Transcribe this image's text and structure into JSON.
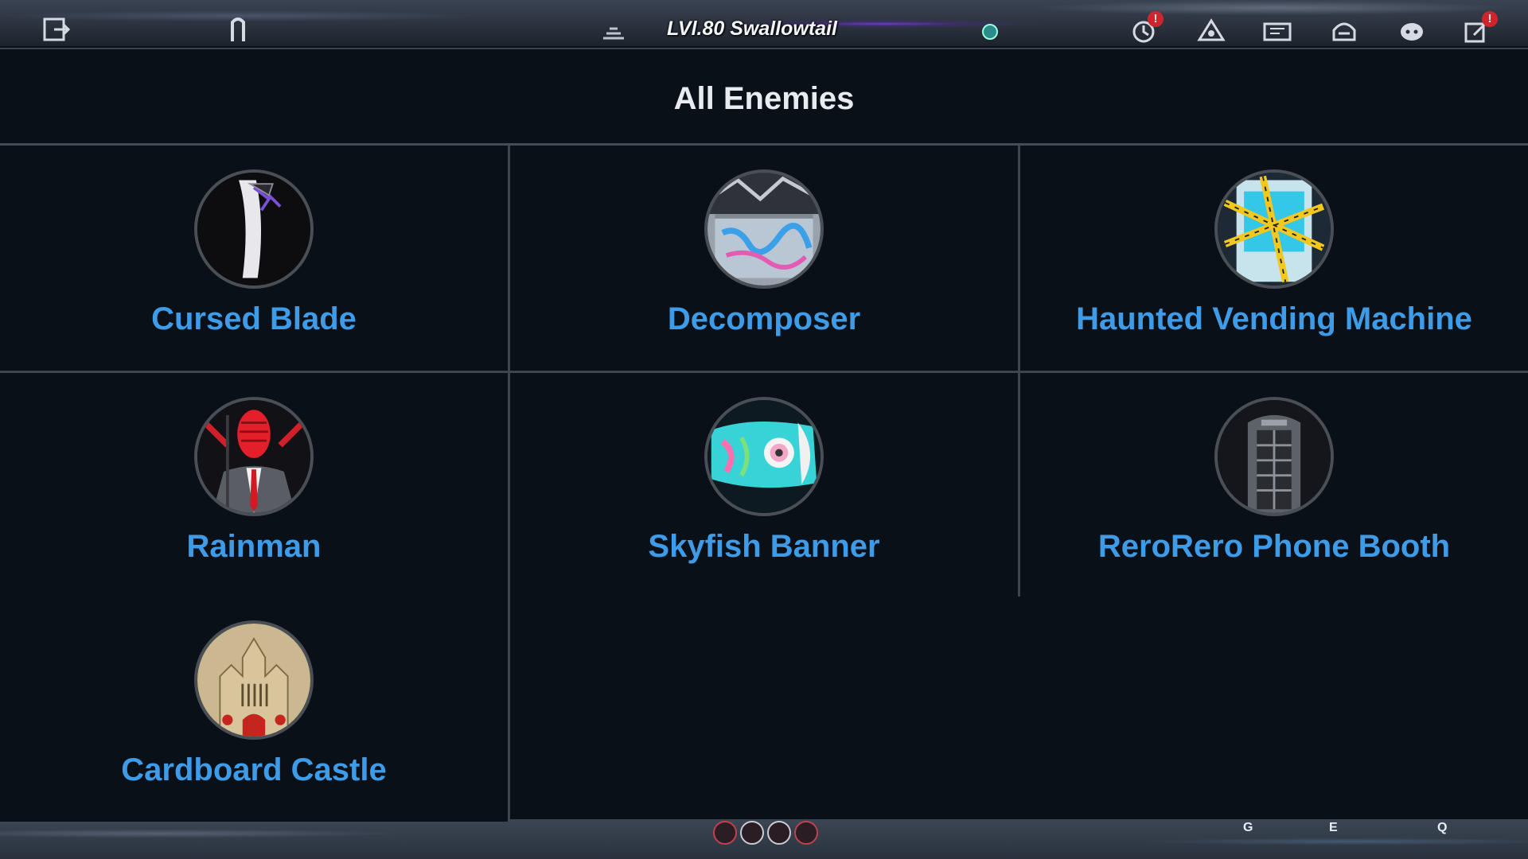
{
  "hud": {
    "player_name": "LVl.80 Swallowtail",
    "icons": [
      "exit-icon",
      "glyph-icon",
      "antenna-icon",
      "quest-icon",
      "party-icon",
      "map-icon",
      "pager-icon",
      "chat-icon",
      "mail-icon"
    ]
  },
  "panel": {
    "title": "All Enemies"
  },
  "enemies": [
    {
      "name": "Cursed Blade",
      "icon": "cursed-blade-portrait"
    },
    {
      "name": "Decomposer",
      "icon": "decomposer-portrait"
    },
    {
      "name": "Haunted Vending Machine",
      "icon": "vending-machine-portrait"
    },
    {
      "name": "Rainman",
      "icon": "rainman-portrait"
    },
    {
      "name": "Skyfish Banner",
      "icon": "skyfish-banner-portrait"
    },
    {
      "name": "ReroRero Phone Booth",
      "icon": "phone-booth-portrait"
    },
    {
      "name": "Cardboard Castle",
      "icon": "cardboard-castle-portrait"
    }
  ],
  "bottom_hud": {
    "key_g": "G",
    "key_e": "E",
    "key_q": "Q"
  },
  "colors": {
    "enemy_name": "#3e9be8",
    "title": "#e8ecf1",
    "badge": "#e0232b"
  }
}
